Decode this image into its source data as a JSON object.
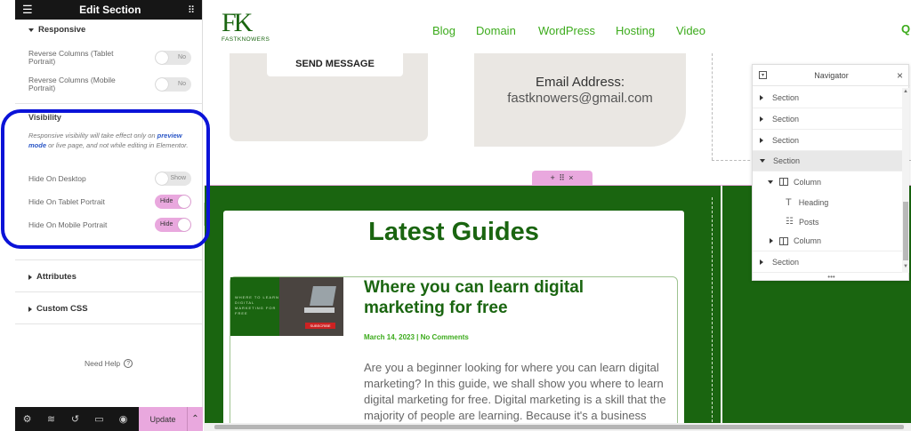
{
  "panel": {
    "title": "Edit Section",
    "responsive_heading": "Responsive",
    "reverse_tablet_label": "Reverse Columns (Tablet Portrait)",
    "reverse_tablet_state": "No",
    "reverse_mobile_label": "Reverse Columns (Mobile Portrait)",
    "reverse_mobile_state": "No",
    "visibility_heading": "Visibility",
    "visibility_note_1": "Responsive visibility will take effect only on",
    "visibility_note_link": "preview mode",
    "visibility_note_2": "or live page, and not while editing in Elementor.",
    "hide_desktop_label": "Hide On Desktop",
    "hide_desktop_state": "Show",
    "hide_tablet_label": "Hide On Tablet Portrait",
    "hide_tablet_state": "Hide",
    "hide_mobile_label": "Hide On Mobile Portrait",
    "hide_mobile_state": "Hide",
    "attributes_heading": "Attributes",
    "custom_css_heading": "Custom CSS",
    "need_help": "Need Help",
    "update_label": "Update"
  },
  "site": {
    "logo_letters": "FK",
    "logo_name": "FASTKNOWERS",
    "menu": [
      "Blog",
      "Domain",
      "WordPress",
      "Hosting",
      "Video"
    ],
    "send_message": "SEND MESSAGE",
    "email_label": "Email Address:",
    "email_value": "fastknowers@gmail.com",
    "section_handle": "+ ⠿ ×",
    "latest_guides": "Latest Guides",
    "post_title": "Where you can learn digital marketing for free",
    "post_meta": "March 14, 2023 | No Comments",
    "post_excerpt": "Are you a beginner looking for where you can learn digital marketing? In this guide, we shall show you where to learn digital marketing for free. Digital marketing is a skill that the majority of people are learning. Because it's a business",
    "thumb_text": "WHERE TO LEARN DIGITAL MARKETING FOR FREE",
    "thumb_button": "SUBSCRIBE"
  },
  "navigator": {
    "title": "Navigator",
    "rows": [
      {
        "label": "Section"
      },
      {
        "label": "Section"
      },
      {
        "label": "Section"
      },
      {
        "label": "Section"
      },
      {
        "label": "Column"
      },
      {
        "label": "Heading"
      },
      {
        "label": "Posts"
      },
      {
        "label": "Column"
      },
      {
        "label": "Section"
      }
    ]
  },
  "colors": {
    "accent": "#e9a8de",
    "brand_green": "#1a6510",
    "menu_green": "#3cab1c",
    "highlight": "#0b13d8"
  }
}
